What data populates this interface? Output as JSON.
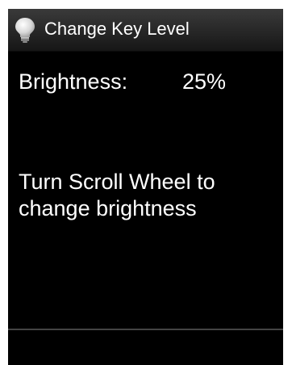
{
  "title_bar": {
    "icon": "lightbulb-icon",
    "title": "Change Key Level"
  },
  "brightness": {
    "label": "Brightness:",
    "value": "25%"
  },
  "instruction": {
    "line1": "Turn Scroll Wheel to",
    "line2": "change brightness"
  },
  "colors": {
    "background": "#000000",
    "text": "#ffffff",
    "title_bar": "#2a2a2a"
  }
}
